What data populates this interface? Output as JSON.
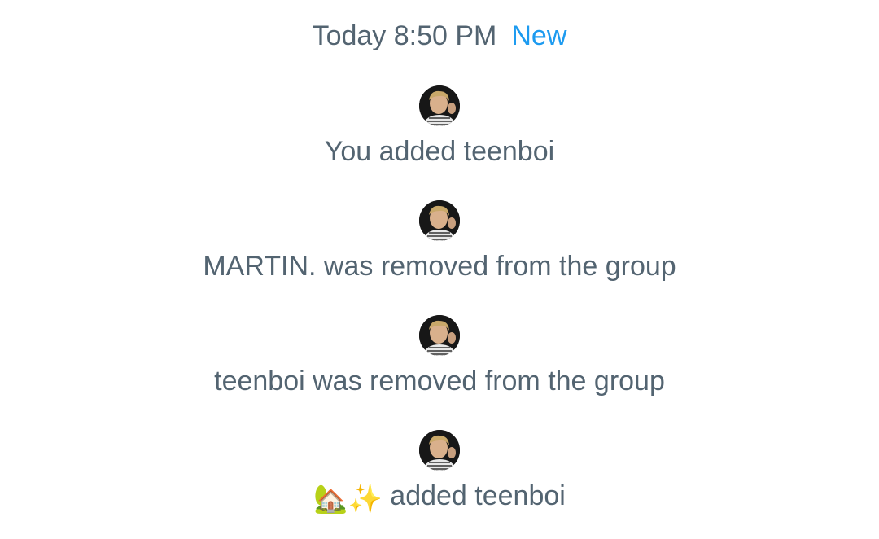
{
  "header": {
    "timestamp": "Today 8:50 PM",
    "new_label": "New"
  },
  "events": [
    {
      "actor": "",
      "text": "You added teenboi"
    },
    {
      "actor": "",
      "text": "MARTIN. was removed from the group"
    },
    {
      "actor": "",
      "text": "teenboi was removed from the group"
    },
    {
      "actor": "🏡✨",
      "text": " added teenboi"
    }
  ],
  "colors": {
    "text": "#536471",
    "accent": "#1d9bf0",
    "background": "#ffffff"
  },
  "icons": {
    "avatar": "user-avatar-photo"
  }
}
